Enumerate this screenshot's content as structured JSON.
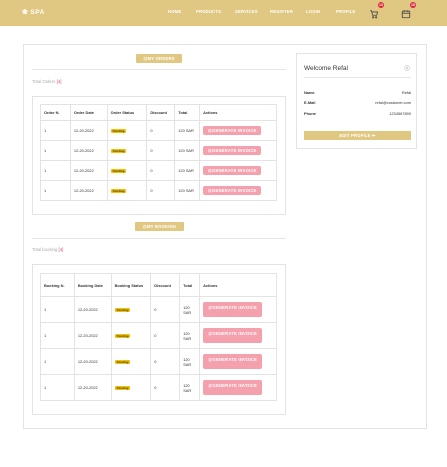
{
  "brand": {
    "name": "SPA"
  },
  "nav": {
    "items": [
      "HOME",
      "PRODUCTS",
      "SERVICES",
      "REGISTER",
      "LOGIN",
      "PROFILE"
    ],
    "cart_count": "13",
    "calendar_count": "18"
  },
  "orders": {
    "heading": "@MY ORDERS",
    "total_label": "Total Orders",
    "total_count": "[4]",
    "columns": [
      "Order N.",
      "Order Date",
      "Order Status",
      "Discount",
      "Total",
      "Actions"
    ],
    "rows": [
      {
        "no": "1",
        "date": "12-20-2022",
        "status": "Pending",
        "discount": "0",
        "total": "120 SAR",
        "action": "@GENERATE INVOICE"
      },
      {
        "no": "1",
        "date": "12-20-2022",
        "status": "Pending",
        "discount": "0",
        "total": "120 SAR",
        "action": "@GENERATE INVOICE"
      },
      {
        "no": "1",
        "date": "12-20-2022",
        "status": "Pending",
        "discount": "0",
        "total": "120 SAR",
        "action": "@GENERATE INVOICE"
      },
      {
        "no": "1",
        "date": "12-20-2022",
        "status": "Pending",
        "discount": "0",
        "total": "120 SAR",
        "action": "@GENERATE INVOICE"
      }
    ]
  },
  "bookings": {
    "heading": "@MY BOOKING",
    "total_label": "Total booking",
    "total_count": "[4]",
    "columns": [
      "Booking N.",
      "Booking Date",
      "Booking Status",
      "Discount",
      "Total",
      "Actions"
    ],
    "rows": [
      {
        "no": "1",
        "date": "12-20-2022",
        "status": "Pending",
        "discount": "0",
        "total": "120 SAR",
        "action": "@GENERATE INVOICE"
      },
      {
        "no": "1",
        "date": "12-20-2022",
        "status": "Pending",
        "discount": "0",
        "total": "120 SAR",
        "action": "@GENERATE INVOICE"
      },
      {
        "no": "1",
        "date": "12-20-2022",
        "status": "Pending",
        "discount": "0",
        "total": "120 SAR",
        "action": "@GENERATE INVOICE"
      },
      {
        "no": "1",
        "date": "12-20-2022",
        "status": "Pending",
        "discount": "0",
        "total": "120 SAR",
        "action": "@GENERATE INVOICE"
      }
    ]
  },
  "profile": {
    "welcome": "Welcome Refal",
    "fields": [
      {
        "label": "Name",
        "value": "Refal"
      },
      {
        "label": "E-Mail",
        "value": "refal@customer.com"
      },
      {
        "label": "Phone",
        "value": "1234567890"
      }
    ],
    "edit_label": "EDIT PROFILE ✏"
  },
  "colors": {
    "accent": "#e0c883",
    "button_pink": "#f5a0ad",
    "status_yellow": "#f2c200",
    "badge_red": "#e0233b"
  },
  "icons": {
    "logo": "lotus-icon",
    "cart": "cart-icon",
    "calendar": "calendar-icon",
    "user": "user-icon"
  }
}
